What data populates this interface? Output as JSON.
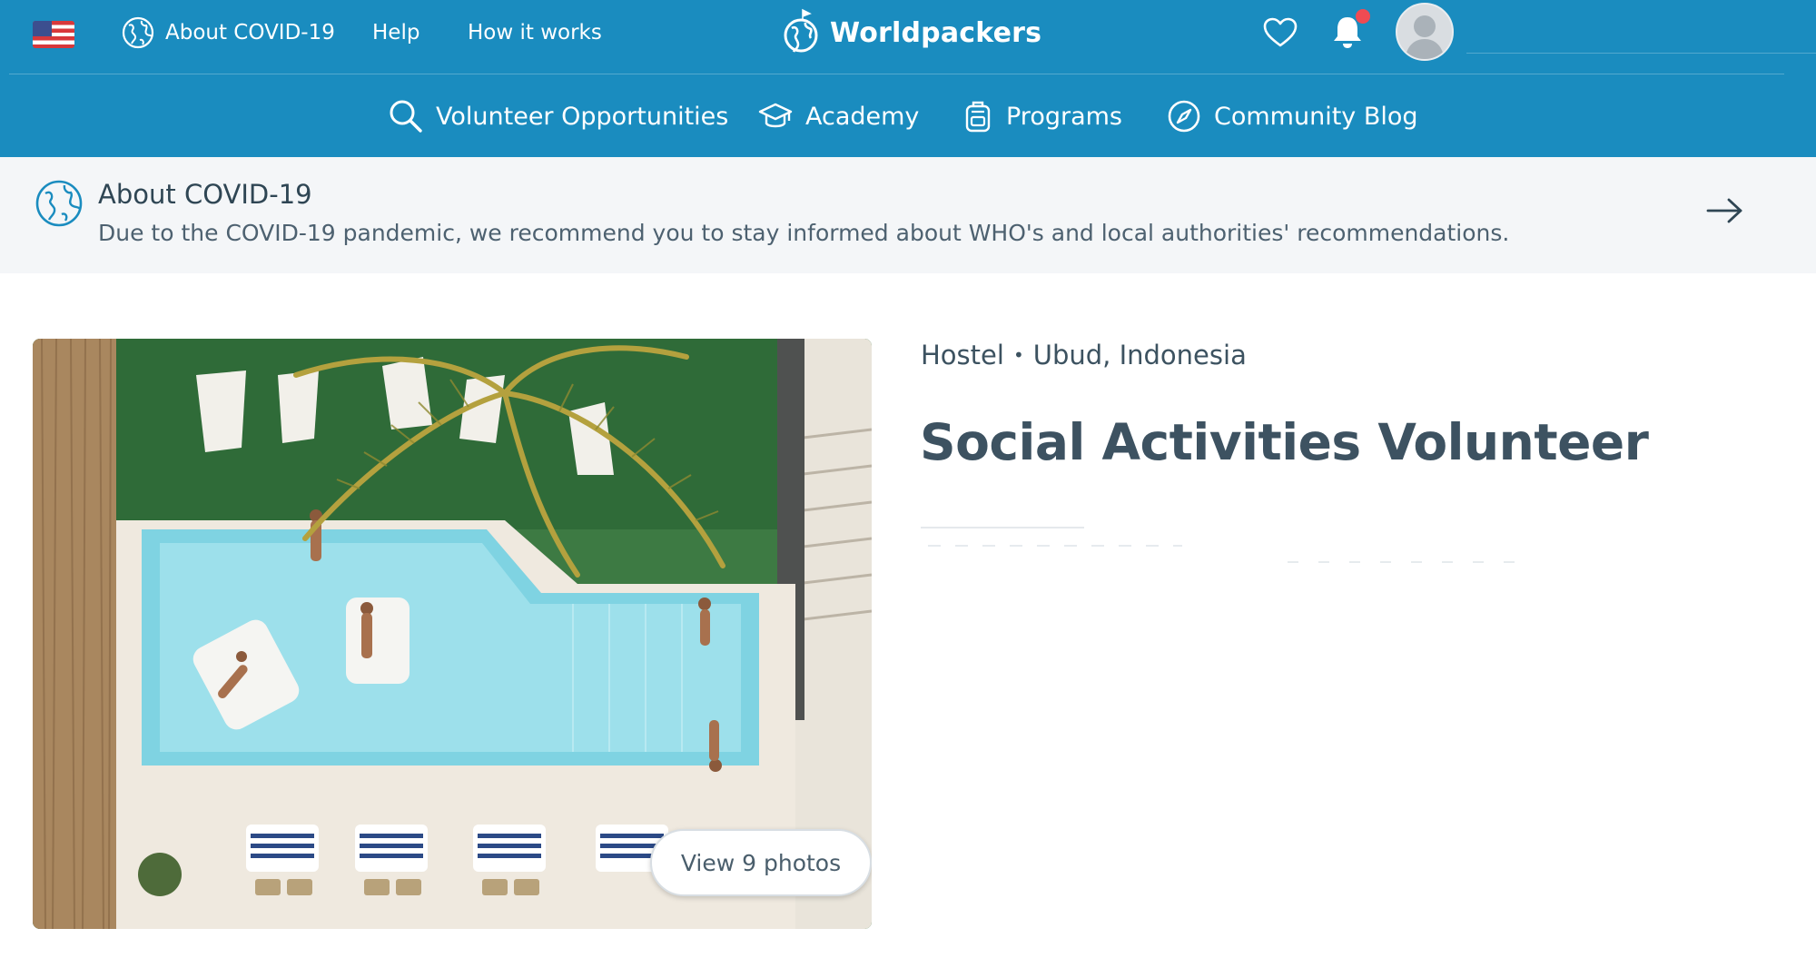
{
  "colors": {
    "brand_blue": "#1a8cbf",
    "banner_bg": "#f4f6f8",
    "title_text": "#3d5261",
    "notification_dot": "#ef4b53"
  },
  "header": {
    "country_flag": "us-flag-icon",
    "top_links": [
      {
        "label": "About COVID-19",
        "icon": "globe-icon"
      },
      {
        "label": "Help"
      },
      {
        "label": "How it works"
      }
    ],
    "brand": {
      "name": "Worldpackers",
      "icon": "globe-logo-icon"
    },
    "actions": [
      {
        "icon": "heart-icon"
      },
      {
        "icon": "bell-icon",
        "has_badge": true
      },
      {
        "icon": "avatar"
      }
    ]
  },
  "nav": {
    "items": [
      {
        "label": "Volunteer Opportunities",
        "icon": "search-icon"
      },
      {
        "label": "Academy",
        "icon": "graduation-cap-icon"
      },
      {
        "label": "Programs",
        "icon": "backpack-icon"
      },
      {
        "label": "Community Blog",
        "icon": "compass-icon"
      }
    ]
  },
  "banner": {
    "title": "About COVID-19",
    "text": "Due to the COVID-19 pandemic, we recommend you to stay informed about WHO's and local authorities' recommendations.",
    "icon": "globe-icon",
    "action_icon": "arrow-right-icon"
  },
  "listing": {
    "type": "Hostel",
    "separator": "•",
    "location": "Ubud, Indonesia",
    "title": "Social Activities Volunteer",
    "photo_button": "View 9 photos"
  }
}
